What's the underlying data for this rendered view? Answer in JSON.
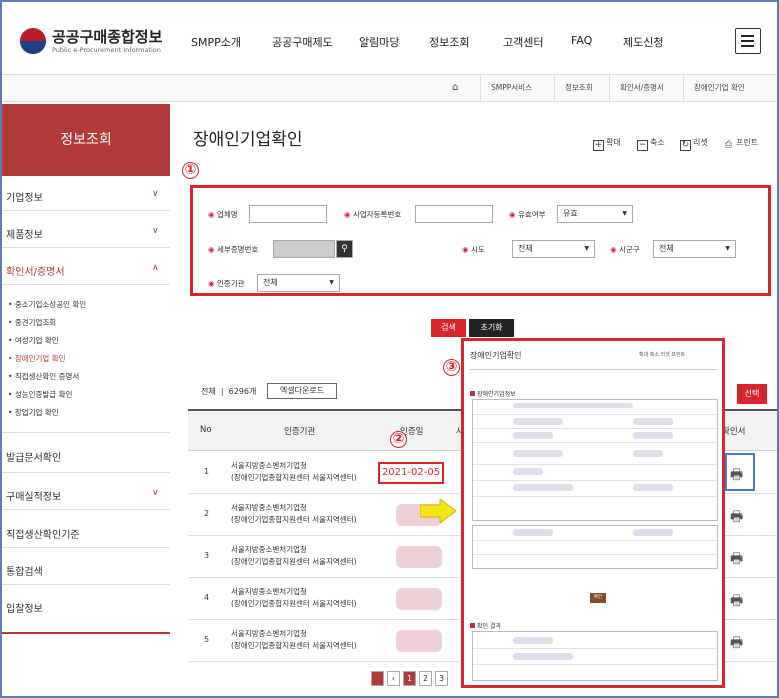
{
  "header": {
    "logo_title": "공공구매종합정보",
    "logo_sub": "Public e-Procurement Information",
    "nav": [
      "SMPP소개",
      "공공구매제도",
      "알림마당",
      "정보조회",
      "고객센터",
      "FAQ",
      "제도신청"
    ]
  },
  "breadcrumb": [
    "SMPP서비스",
    "정보조회",
    "확인서/증명서",
    "장애인기업 확인"
  ],
  "sidebar": {
    "heading": "정보조회",
    "items": [
      {
        "label": "기업정보",
        "arrow": "∨"
      },
      {
        "label": "제품정보",
        "arrow": "∨"
      },
      {
        "label": "확인서/증명서",
        "arrow": "∧"
      }
    ],
    "subitems": [
      "중소기업소상공인 확인",
      "중견기업조회",
      "여성기업 확인",
      "장애인기업 확인",
      "직접생산확인 증명서",
      "성능인증발급 확인",
      "창업기업 확인"
    ],
    "more": [
      {
        "label": "발급문서확인",
        "arrow": ""
      },
      {
        "label": "구매실적정보",
        "arrow": "∨"
      },
      {
        "label": "직접생산확인기준",
        "arrow": ""
      },
      {
        "label": "통합검색",
        "arrow": ""
      },
      {
        "label": "입찰정보",
        "arrow": ""
      }
    ]
  },
  "page": {
    "title": "장애인기업확인",
    "tools": [
      {
        "icon": "+",
        "label": "확대"
      },
      {
        "icon": "−",
        "label": "축소"
      },
      {
        "icon": "↻",
        "label": "리셋"
      },
      {
        "icon": "⎙",
        "label": "프린트"
      }
    ]
  },
  "annotations": [
    "①",
    "②",
    "③"
  ],
  "search": {
    "company_label": "업체명",
    "bizno_label": "사업자등록번호",
    "valid_label": "유효여부",
    "valid_value": "유효",
    "cert_label": "세부증명번호",
    "sido_label": "시도",
    "sido_value": "전체",
    "sigungu_label": "시군구",
    "sigungu_value": "전체",
    "agency_label": "인증기관",
    "agency_value": "전체",
    "search_btn": "검색",
    "reset_btn": "초기화"
  },
  "table": {
    "count_label": "전체",
    "count_value": "6296개",
    "excel": "엑셀다운로드",
    "select_btn": "선택",
    "headers": {
      "no": "No",
      "org": "인증기관",
      "date": "인증일",
      "col4": "사",
      "doc": "확인서"
    },
    "rows": [
      {
        "no": "1",
        "org1": "서울지방중소벤처기업청",
        "org2": "(장애인기업종합지원센터 서울지역센터)",
        "date": "2021-02-05"
      },
      {
        "no": "2",
        "org1": "서울지방중소벤처기업청",
        "org2": "(장애인기업종합지원센터 서울지역센터)",
        "date": ""
      },
      {
        "no": "3",
        "org1": "서울지방중소벤처기업청",
        "org2": "(장애인기업종합지원센터 서울지역센터)",
        "date": ""
      },
      {
        "no": "4",
        "org1": "서울지방중소벤처기업청",
        "org2": "(장애인기업종합지원센터 서울지역센터)",
        "date": ""
      },
      {
        "no": "5",
        "org1": "서울지방중소벤처기업청",
        "org2": "(장애인기업종합지원센터 서울지역센터)",
        "date": ""
      }
    ]
  },
  "pagination": [
    "1",
    "2",
    "3"
  ],
  "popup": {
    "title": "장애인기업확인",
    "tools": "확대 축소 리셋 프린트",
    "section1": "장애인기업정보",
    "section2": "확인 결과",
    "button": "확인"
  },
  "colors": {
    "accent": "#d7262e",
    "sidebar": "#b23b3a",
    "frame": "#5b7fb5",
    "highlight": "#3d7fc4"
  }
}
